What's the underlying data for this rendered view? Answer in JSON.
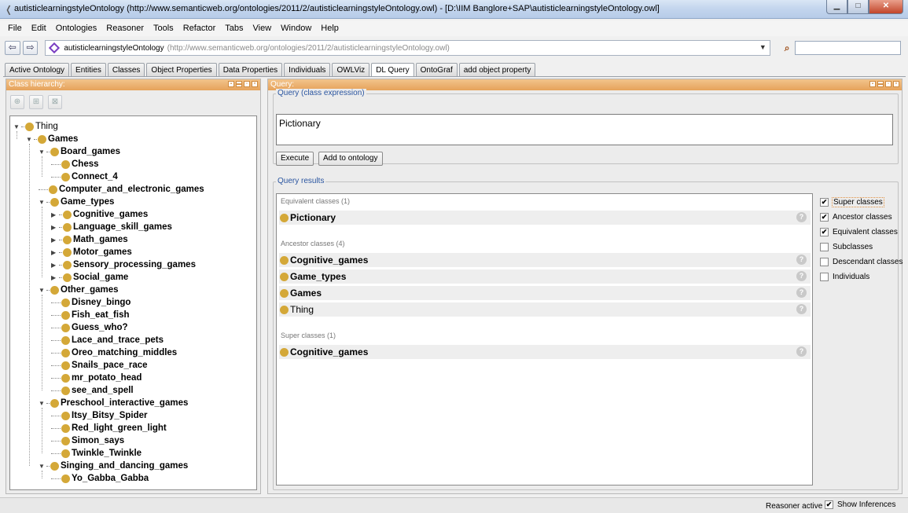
{
  "window": {
    "title": "autisticlearningstyleOntology (http://www.semanticweb.org/ontologies/2011/2/autisticlearningstyleOntology.owl) - [D:\\IIM Banglore+SAP\\autisticlearningstyleOntology.owl]"
  },
  "menu": [
    "File",
    "Edit",
    "Ontologies",
    "Reasoner",
    "Tools",
    "Refactor",
    "Tabs",
    "View",
    "Window",
    "Help"
  ],
  "ontology_bar": {
    "name": "autisticlearningstyleOntology",
    "iri": "(http://www.semanticweb.org/ontologies/2011/2/autisticlearningstyleOntology.owl)"
  },
  "tabs": [
    "Active Ontology",
    "Entities",
    "Classes",
    "Object Properties",
    "Data Properties",
    "Individuals",
    "OWLViz",
    "DL Query",
    "OntoGraf",
    "add object property"
  ],
  "active_tab": "DL Query",
  "class_hierarchy": {
    "title": "Class hierarchy:",
    "nodes": [
      {
        "label": "Thing",
        "depth": 0,
        "expand": "open",
        "bold": false
      },
      {
        "label": "Games",
        "depth": 1,
        "expand": "open",
        "bold": true
      },
      {
        "label": "Board_games",
        "depth": 2,
        "expand": "open",
        "bold": true
      },
      {
        "label": "Chess",
        "depth": 3,
        "expand": "none",
        "bold": true
      },
      {
        "label": "Connect_4",
        "depth": 3,
        "expand": "none",
        "bold": true
      },
      {
        "label": "Computer_and_electronic_games",
        "depth": 2,
        "expand": "none",
        "bold": true
      },
      {
        "label": "Game_types",
        "depth": 2,
        "expand": "open",
        "bold": true
      },
      {
        "label": "Cognitive_games",
        "depth": 3,
        "expand": "closed",
        "bold": true
      },
      {
        "label": "Language_skill_games",
        "depth": 3,
        "expand": "closed",
        "bold": true
      },
      {
        "label": "Math_games",
        "depth": 3,
        "expand": "closed",
        "bold": true
      },
      {
        "label": "Motor_games",
        "depth": 3,
        "expand": "closed",
        "bold": true
      },
      {
        "label": "Sensory_processing_games",
        "depth": 3,
        "expand": "closed",
        "bold": true
      },
      {
        "label": "Social_game",
        "depth": 3,
        "expand": "closed",
        "bold": true
      },
      {
        "label": "Other_games",
        "depth": 2,
        "expand": "open",
        "bold": true
      },
      {
        "label": "Disney_bingo",
        "depth": 3,
        "expand": "none",
        "bold": true
      },
      {
        "label": "Fish_eat_fish",
        "depth": 3,
        "expand": "none",
        "bold": true
      },
      {
        "label": "Guess_who?",
        "depth": 3,
        "expand": "none",
        "bold": true
      },
      {
        "label": "Lace_and_trace_pets",
        "depth": 3,
        "expand": "none",
        "bold": true
      },
      {
        "label": "Oreo_matching_middles",
        "depth": 3,
        "expand": "none",
        "bold": true
      },
      {
        "label": "Snails_pace_race",
        "depth": 3,
        "expand": "none",
        "bold": true
      },
      {
        "label": "mr_potato_head",
        "depth": 3,
        "expand": "none",
        "bold": true
      },
      {
        "label": "see_and_spell",
        "depth": 3,
        "expand": "none",
        "bold": true
      },
      {
        "label": "Preschool_interactive_games",
        "depth": 2,
        "expand": "open",
        "bold": true
      },
      {
        "label": "Itsy_Bitsy_Spider",
        "depth": 3,
        "expand": "none",
        "bold": true
      },
      {
        "label": "Red_light_green_light",
        "depth": 3,
        "expand": "none",
        "bold": true
      },
      {
        "label": "Simon_says",
        "depth": 3,
        "expand": "none",
        "bold": true
      },
      {
        "label": "Twinkle_Twinkle",
        "depth": 3,
        "expand": "none",
        "bold": true
      },
      {
        "label": "Singing_and_dancing_games",
        "depth": 2,
        "expand": "open",
        "bold": true
      },
      {
        "label": "Yo_Gabba_Gabba",
        "depth": 3,
        "expand": "none",
        "bold": true
      }
    ]
  },
  "query_panel": {
    "title": "Query:",
    "expression_label": "Query (class expression)",
    "expression": "Pictionary",
    "execute_label": "Execute",
    "add_label": "Add to ontology",
    "results_label": "Query results",
    "sections": [
      {
        "title": "Equivalent classes (1)",
        "items": [
          {
            "label": "Pictionary",
            "bold": true
          }
        ]
      },
      {
        "title": "Ancestor classes (4)",
        "items": [
          {
            "label": "Cognitive_games",
            "bold": true
          },
          {
            "label": "Game_types",
            "bold": true
          },
          {
            "label": "Games",
            "bold": true
          },
          {
            "label": "Thing",
            "bold": false
          }
        ]
      },
      {
        "title": "Super classes (1)",
        "items": [
          {
            "label": "Cognitive_games",
            "bold": true
          }
        ]
      }
    ],
    "options": [
      {
        "label": "Super classes",
        "checked": true
      },
      {
        "label": "Ancestor classes",
        "checked": true
      },
      {
        "label": "Equivalent classes",
        "checked": true
      },
      {
        "label": "Subclasses",
        "checked": false
      },
      {
        "label": "Descendant classes",
        "checked": false
      },
      {
        "label": "Individuals",
        "checked": false
      }
    ]
  },
  "status": {
    "reasoner": "Reasoner active",
    "show_inferences": "Show Inferences",
    "show_inferences_checked": true
  },
  "colors": {
    "class_dot": "#d4a838",
    "panel_header": "#e6a25a",
    "group_title": "#2a55a0"
  }
}
